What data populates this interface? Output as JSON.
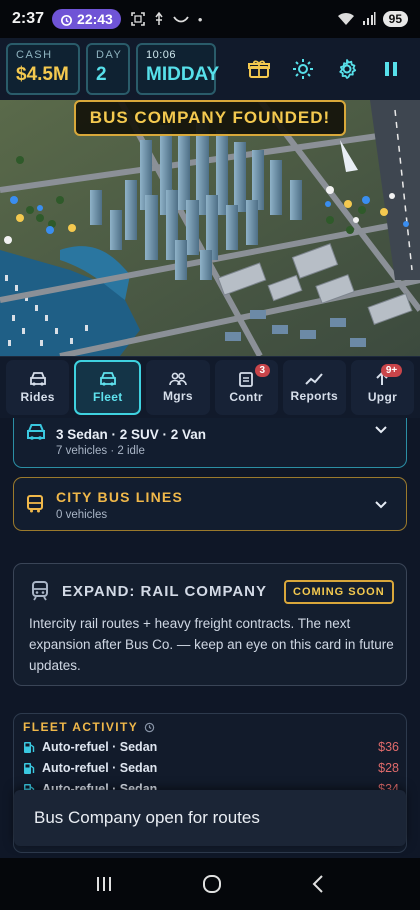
{
  "status_bar": {
    "time": "2:37",
    "alarm": "22:43",
    "battery": "95"
  },
  "hud": {
    "cash_label": "CASH",
    "cash_value": "$4.5M",
    "day_label": "DAY",
    "day_value": "2",
    "clock_label": "10:06",
    "clock_value": "MIDDAY"
  },
  "banner": "BUS COMPANY FOUNDED!",
  "tabs": [
    {
      "label": "Rides",
      "icon": "car-icon"
    },
    {
      "label": "Fleet",
      "icon": "car-icon",
      "active": true
    },
    {
      "label": "Mgrs",
      "icon": "people-icon"
    },
    {
      "label": "Contr",
      "icon": "clipboard-icon",
      "badge": "3"
    },
    {
      "label": "Reports",
      "icon": "trend-icon"
    },
    {
      "label": "Upgr",
      "icon": "upgrade-icon",
      "badge": "9+"
    }
  ],
  "fleet": {
    "summary": "3 Sedan · 2 SUV · 2 Van",
    "detail": "7 vehicles · 2 idle"
  },
  "bus_lines": {
    "title": "CITY BUS LINES",
    "detail": "0 vehicles"
  },
  "rail": {
    "title": "EXPAND: RAIL COMPANY",
    "badge": "COMING SOON",
    "description": "Intercity rail routes + heavy freight contracts. The next expansion after Bus Co. — keep an eye on this card in future updates."
  },
  "activity": {
    "title": "FLEET ACTIVITY",
    "rows": [
      {
        "text": "Auto-refuel · Sedan",
        "amount": "$36"
      },
      {
        "text": "Auto-refuel · Sedan",
        "amount": "$28"
      },
      {
        "text": "Auto-refuel · Sedan",
        "amount": "$34"
      }
    ]
  },
  "toast": "Bus Company open for routes",
  "colors": {
    "accent_cyan": "#3fd2e0",
    "accent_gold": "#f4c94f",
    "expense_red": "#e06b6b",
    "badge_red": "#c9454a"
  }
}
